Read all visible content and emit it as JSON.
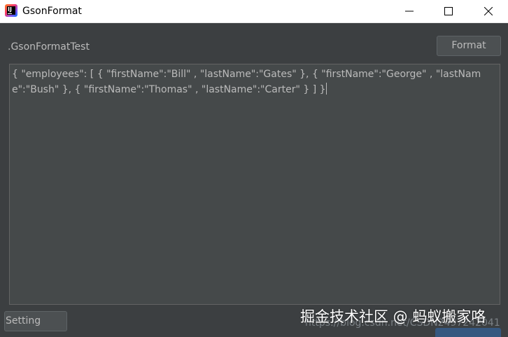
{
  "window": {
    "title": "GsonFormat",
    "controls": {
      "minimize_icon": "minimize-icon",
      "maximize_icon": "maximize-icon",
      "close_icon": "close-icon"
    }
  },
  "header": {
    "class_label": ".GsonFormatTest",
    "format_button": "Format"
  },
  "editor": {
    "content": "{ \"employees\": [ { \"firstName\":\"Bill\" , \"lastName\":\"Gates\" }, { \"firstName\":\"George\" , \"lastName\":\"Bush\" }, { \"firstName\":\"Thomas\" , \"lastName\":\"Carter\" } ] }"
  },
  "footer": {
    "setting_button": "Setting",
    "url_text": "https://blog.csdn.net/CSDN2497242041",
    "watermark": "掘金技术社区 @ 蚂蚁搬家咯"
  },
  "colors": {
    "background": "#3c3f41",
    "editor_background": "#45494a",
    "text": "#bbbbbb",
    "accent_button": "#365880"
  }
}
